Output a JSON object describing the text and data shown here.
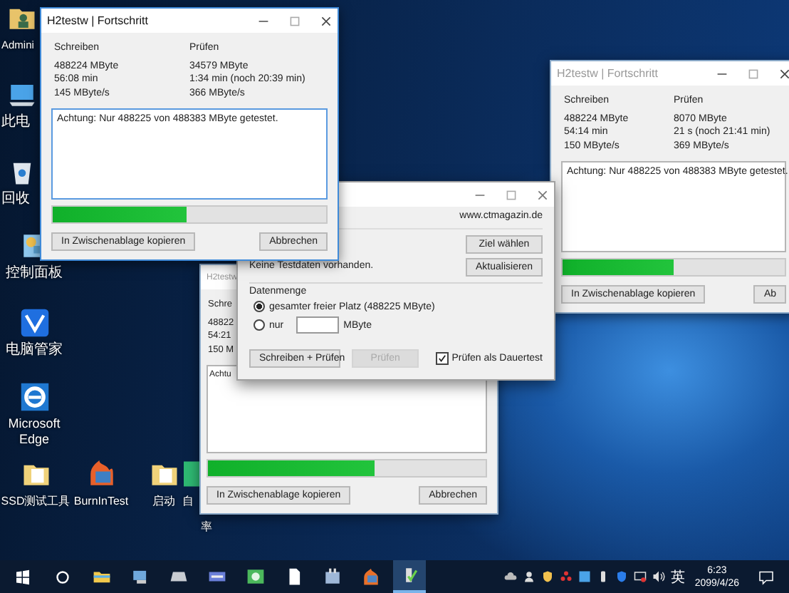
{
  "desktop_icons": [
    {
      "label": "Admini"
    },
    {
      "label": "此电"
    },
    {
      "label": "回收"
    },
    {
      "label": "控制面板"
    },
    {
      "label": "电脑管家"
    },
    {
      "label": "Microsoft Edge"
    }
  ],
  "desktop_icons_bottom": [
    {
      "label": "SSD测试工具"
    },
    {
      "label": "BurnInTest"
    },
    {
      "label": "启动"
    },
    {
      "label": "自",
      "label_continued": "率"
    }
  ],
  "windows": [
    {
      "active": false,
      "title": "H2testw | Fortschritt",
      "write": {
        "label": "Schreiben",
        "lines": [
          "488224 MByte",
          "54:14 min",
          "150 MByte/s"
        ]
      },
      "verify": {
        "label": "Prüfen",
        "lines": [
          "8070 MByte",
          "21 s (noch 21:41 min)",
          "369 MByte/s"
        ]
      },
      "message": "Achtung: Nur 488225 von 488383 MByte getestet.",
      "level": 0.5,
      "buttons": [
        "In Zwischenablage kopieren",
        "Ab"
      ]
    },
    {
      "active": false,
      "title": "H2testw",
      "write": {
        "label": "Schre",
        "lines": [
          "48822",
          "54:21",
          "150 M"
        ]
      },
      "message": "Achtu",
      "level": 0.6,
      "buttons": [
        "In Zwischenablage kopieren",
        "Abbrechen"
      ]
    },
    {
      "active": true,
      "title": "H2testw | Fortschritt",
      "write": {
        "label": "Schreiben",
        "lines": [
          "488224 MByte",
          "56:08 min",
          "145 MByte/s"
        ]
      },
      "verify": {
        "label": "Prüfen",
        "lines": [
          "34579 MByte",
          "1:34 min (noch 20:39 min)",
          "366 MByte/s"
        ]
      },
      "message": "Achtung: Nur 488225 von 488383 MByte getestet.",
      "level": 0.49,
      "buttons": [
        "In Zwischenablage kopieren",
        "Abbrechen"
      ]
    }
  ],
  "dialog": {
    "website": "www.ctmagazin.de",
    "target_buttons": [
      "Ziel wählen",
      "Aktualisieren"
    ],
    "status": "Keine Testdaten vorhanden.",
    "group_label": "Datenmenge",
    "options": [
      {
        "kind": "whole",
        "label": "gesamter freier Platz (488225 MByte)",
        "selected": true
      },
      {
        "kind": "amount",
        "label": "nur",
        "selected": false,
        "unit": "MByte"
      }
    ],
    "actions": [
      {
        "label": "Schreiben + Prüfen",
        "disabled": false
      },
      {
        "label": "Prüfen",
        "disabled": true
      }
    ],
    "endless": {
      "label": "Prüfen als Dauertest",
      "checked": true
    }
  },
  "taskbar": {
    "apps": [
      {
        "selected": false
      },
      {
        "selected": false
      },
      {
        "selected": false
      },
      {
        "selected": false
      },
      {
        "selected": false
      },
      {
        "selected": false
      },
      {
        "selected": false
      },
      {
        "selected": false
      },
      {
        "selected": true
      }
    ],
    "language": "英",
    "time": "6:23",
    "date": "2099/4/26"
  }
}
